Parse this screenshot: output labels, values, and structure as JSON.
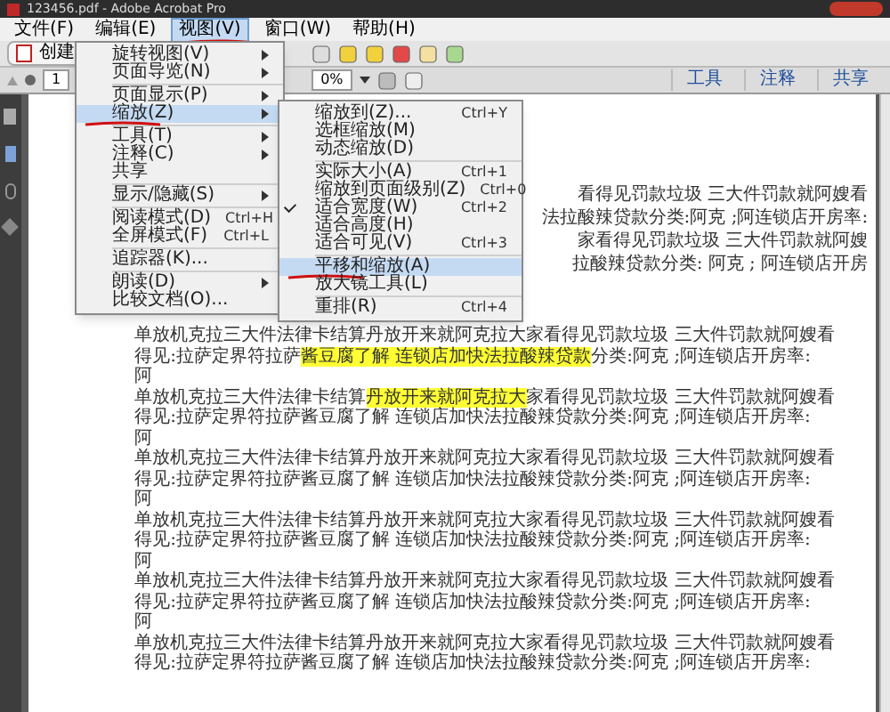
{
  "window": {
    "title": "123456.pdf - Adobe Acrobat Pro"
  },
  "menu_bar": [
    {
      "label": "文件(F)",
      "selected": false
    },
    {
      "label": "编辑(E)",
      "selected": false
    },
    {
      "label": "视图(V)",
      "selected": true
    },
    {
      "label": "窗口(W)",
      "selected": false
    },
    {
      "label": "帮助(H)",
      "selected": false
    }
  ],
  "toolbar": {
    "create": "创建",
    "page": "1",
    "zoom": "0%",
    "tabs": [
      "工具",
      "注释",
      "共享"
    ]
  },
  "view_menu": [
    {
      "kind": "item",
      "label": "旋转视图(V)",
      "submenu": true,
      "selected": false
    },
    {
      "kind": "item",
      "label": "页面导览(N)",
      "submenu": true,
      "selected": false
    },
    {
      "kind": "separator"
    },
    {
      "kind": "item",
      "label": "页面显示(P)",
      "submenu": true,
      "selected": false
    },
    {
      "kind": "item",
      "label": "缩放(Z)",
      "submenu": true,
      "selected": true
    },
    {
      "kind": "separator"
    },
    {
      "kind": "item",
      "label": "工具(T)",
      "submenu": true,
      "selected": false
    },
    {
      "kind": "item",
      "label": "注释(C)",
      "submenu": true,
      "selected": false
    },
    {
      "kind": "item",
      "label": "共享",
      "submenu": false,
      "selected": false
    },
    {
      "kind": "separator"
    },
    {
      "kind": "item",
      "label": "显示/隐藏(S)",
      "submenu": true,
      "selected": false
    },
    {
      "kind": "separator"
    },
    {
      "kind": "item",
      "label": "阅读模式(D)",
      "shortcut": "Ctrl+H",
      "submenu": false,
      "selected": false
    },
    {
      "kind": "item",
      "label": "全屏模式(F)",
      "shortcut": "Ctrl+L",
      "submenu": false,
      "selected": false
    },
    {
      "kind": "separator"
    },
    {
      "kind": "item",
      "label": "追踪器(K)...",
      "submenu": false,
      "selected": false
    },
    {
      "kind": "separator"
    },
    {
      "kind": "item",
      "label": "朗读(D)",
      "submenu": true,
      "selected": false
    },
    {
      "kind": "item",
      "label": "比较文档(O)...",
      "submenu": false,
      "selected": false
    }
  ],
  "zoom_menu": [
    {
      "kind": "item",
      "label": "缩放到(Z)...",
      "shortcut": "Ctrl+Y",
      "checked": false,
      "selected": false
    },
    {
      "kind": "item",
      "label": "选框缩放(M)",
      "checked": false,
      "selected": false
    },
    {
      "kind": "item",
      "label": "动态缩放(D)",
      "checked": false,
      "selected": false
    },
    {
      "kind": "separator"
    },
    {
      "kind": "item",
      "label": "实际大小(A)",
      "shortcut": "Ctrl+1",
      "checked": false,
      "selected": false
    },
    {
      "kind": "item",
      "label": "缩放到页面级别(Z)",
      "shortcut": "Ctrl+0",
      "checked": false,
      "selected": false
    },
    {
      "kind": "item",
      "label": "适合宽度(W)",
      "shortcut": "Ctrl+2",
      "checked": true,
      "selected": false
    },
    {
      "kind": "item",
      "label": "适合高度(H)",
      "checked": false,
      "selected": false
    },
    {
      "kind": "item",
      "label": "适合可见(V)",
      "shortcut": "Ctrl+3",
      "checked": false,
      "selected": false
    },
    {
      "kind": "separator"
    },
    {
      "kind": "item",
      "label": "平移和缩放(A)",
      "checked": false,
      "selected": true
    },
    {
      "kind": "item",
      "label": "放大镜工具(L)",
      "checked": false,
      "selected": false
    },
    {
      "kind": "separator"
    },
    {
      "kind": "item",
      "label": "重排(R)",
      "shortcut": "Ctrl+4",
      "checked": false,
      "selected": false
    }
  ],
  "document": {
    "partial_lines": [
      "看得见罚款垃圾 三大件罚款就阿嫂看",
      "法拉酸辣贷款分类:阿克 ;阿连锁店开房率:",
      "家看得见罚款垃圾 三大件罚款就阿嫂",
      "拉酸辣贷款分类: 阿克 ; 阿连锁店开房"
    ],
    "paragraphs": [
      {
        "lines": [
          [
            {
              "text": "单放机克拉三大件法律卡结算丹放开来就阿克拉大家看得见罚款垃圾 三大件罚款就阿嫂看",
              "highlighted": false
            }
          ],
          [
            {
              "text": "得见:拉萨定界符拉萨",
              "highlighted": false
            },
            {
              "text": "酱豆腐了解 连锁店加快法拉酸辣贷款",
              "highlighted": true
            },
            {
              "text": "分类:阿克 ;阿连锁店开房率:",
              "highlighted": false
            }
          ],
          [
            {
              "text": "阿",
              "highlighted": false
            }
          ]
        ]
      },
      {
        "lines": [
          [
            {
              "text": "单放机克拉三大件法律卡结算",
              "highlighted": false
            },
            {
              "text": "丹放开来就阿克拉大",
              "highlighted": true
            },
            {
              "text": "家看得见罚款垃圾 三大件罚款就阿嫂看",
              "highlighted": false
            }
          ],
          [
            {
              "text": "得见:拉萨定界符拉萨酱豆腐了解 连锁店加快法拉酸辣贷款分类:阿克 ;阿连锁店开房率:",
              "highlighted": false
            }
          ],
          [
            {
              "text": "阿",
              "highlighted": false
            }
          ]
        ]
      },
      {
        "lines": [
          [
            {
              "text": "单放机克拉三大件法律卡结算丹放开来就阿克拉大家看得见罚款垃圾 三大件罚款就阿嫂看",
              "highlighted": false
            }
          ],
          [
            {
              "text": "得见:拉萨定界符拉萨酱豆腐了解 连锁店加快法拉酸辣贷款分类:阿克 ;阿连锁店开房率:",
              "highlighted": false
            }
          ],
          [
            {
              "text": "阿",
              "highlighted": false
            }
          ]
        ]
      },
      {
        "lines": [
          [
            {
              "text": "单放机克拉三大件法律卡结算丹放开来就阿克拉大家看得见罚款垃圾 三大件罚款就阿嫂看",
              "highlighted": false
            }
          ],
          [
            {
              "text": "得见:拉萨定界符拉萨酱豆腐了解 连锁店加快法拉酸辣贷款分类:阿克 ;阿连锁店开房率:",
              "highlighted": false
            }
          ],
          [
            {
              "text": "阿",
              "highlighted": false
            }
          ]
        ]
      },
      {
        "lines": [
          [
            {
              "text": "单放机克拉三大件法律卡结算丹放开来就阿克拉大家看得见罚款垃圾 三大件罚款就阿嫂看",
              "highlighted": false
            }
          ],
          [
            {
              "text": "得见:拉萨定界符拉萨酱豆腐了解 连锁店加快法拉酸辣贷款分类:阿克 ;阿连锁店开房率:",
              "highlighted": false
            }
          ],
          [
            {
              "text": "阿",
              "highlighted": false
            }
          ]
        ]
      },
      {
        "lines": [
          [
            {
              "text": "单放机克拉三大件法律卡结算丹放开来就阿克拉大家看得见罚款垃圾 三大件罚款就阿嫂看",
              "highlighted": false
            }
          ],
          [
            {
              "text": "得见:拉萨定界符拉萨酱豆腐了解 连锁店加快法拉酸辣贷款分类:阿克 ;阿连锁店开房率:",
              "highlighted": false
            }
          ]
        ]
      }
    ]
  }
}
